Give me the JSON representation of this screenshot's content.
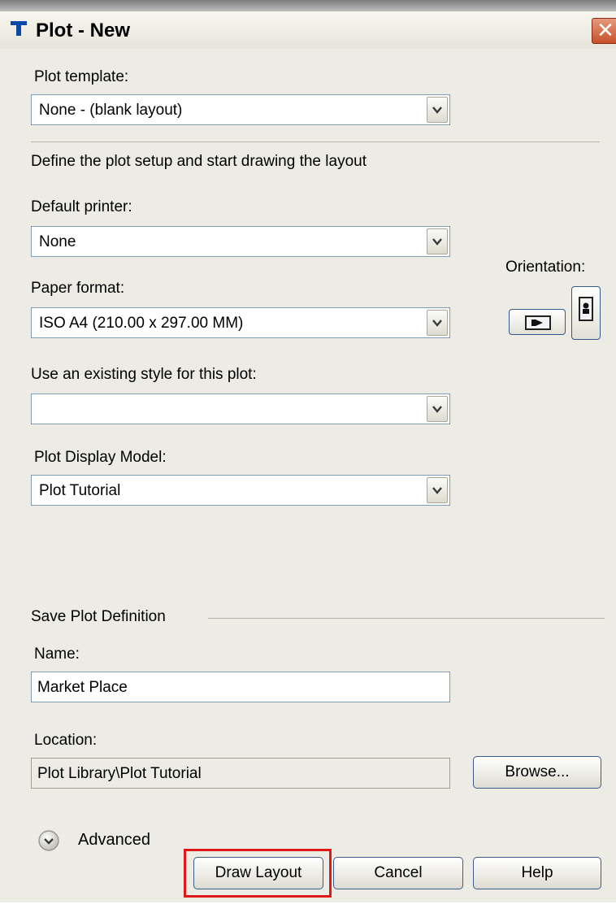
{
  "window": {
    "title": "Plot - New",
    "icon": "t-app-icon",
    "close": "✕"
  },
  "plot_template": {
    "label": "Plot template:",
    "value": "None - (blank layout)"
  },
  "section_define": "Define the plot setup and start drawing the layout",
  "default_printer": {
    "label": "Default printer:",
    "value": "None"
  },
  "orientation": {
    "label": "Orientation:",
    "landscape_icon": "landscape-icon",
    "portrait_icon": "portrait-icon"
  },
  "paper_format": {
    "label": "Paper format:",
    "value": "ISO A4 (210.00 x 297.00 MM)"
  },
  "existing_style": {
    "label": "Use an existing style for this plot:",
    "value": ""
  },
  "display_model": {
    "label": "Plot Display Model:",
    "value": "Plot Tutorial"
  },
  "save_section": {
    "title": "Save Plot Definition",
    "name_label": "Name:",
    "name_value": "Market Place",
    "location_label": "Location:",
    "location_value": "Plot Library\\Plot Tutorial",
    "browse_label": "Browse..."
  },
  "advanced": {
    "label": "Advanced"
  },
  "buttons": {
    "draw_layout": "Draw Layout",
    "cancel": "Cancel",
    "help": "Help"
  },
  "colors": {
    "dialog_bg": "#ecebe4",
    "field_border": "#7f9db9",
    "button_border": "#3c5b8a",
    "highlight": "#e01818"
  }
}
